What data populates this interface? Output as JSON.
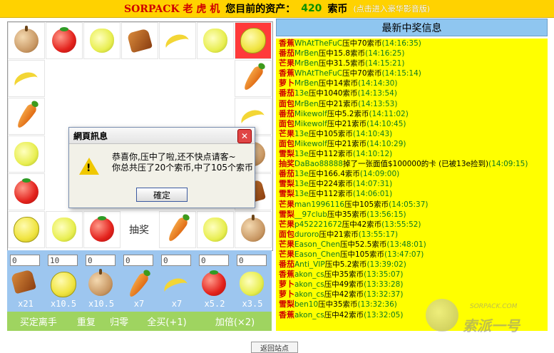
{
  "header": {
    "brand": "SORPACK 老 虎 机",
    "assets_label": "您目前的资产：",
    "assets_value": "420",
    "currency": "索币",
    "deluxe_link": "(点击进入豪华影音版)"
  },
  "board": {
    "lottery_label": "抽奖"
  },
  "bets": [
    {
      "value": "0",
      "icon": "bread-icon",
      "multiplier": "x21"
    },
    {
      "value": "10",
      "icon": "lemon-icon",
      "multiplier": "x10.5"
    },
    {
      "value": "0",
      "icon": "apple-icon",
      "multiplier": "x10.5"
    },
    {
      "value": "0",
      "icon": "carrot-icon",
      "multiplier": "x7"
    },
    {
      "value": "0",
      "icon": "banana-icon",
      "multiplier": "x7"
    },
    {
      "value": "0",
      "icon": "tomato-icon",
      "multiplier": "x5.2"
    },
    {
      "value": "0",
      "icon": "pear-icon",
      "multiplier": "x3.5"
    }
  ],
  "buttons": {
    "cash_out": "买定离手",
    "repeat": "重复",
    "reset": "归零",
    "buy_all": "全买(+1)",
    "double": "加倍(×2)"
  },
  "dialog": {
    "title": "網頁訊息",
    "line1": "恭喜你,压中了啦,还不快点请客~",
    "line2": "你总共压了20个索币,中了105个索币",
    "ok": "確定",
    "close": "✕"
  },
  "panel": {
    "title": "最新中奖信息",
    "entries": [
      {
        "fruit": "香蕉",
        "user": "WhAtTheFuC",
        "text": "压中70索币",
        "time": "(14:16:35)"
      },
      {
        "fruit": "番茄",
        "user": "MrBen",
        "text": "压中15.8索币",
        "time": "(14:16:25)"
      },
      {
        "fruit": "芒果",
        "user": "MrBen",
        "text": "压中31.5索币",
        "time": "(14:15:21)"
      },
      {
        "fruit": "香蕉",
        "user": "WhAtTheFuC",
        "text": "压中70索币",
        "time": "(14:15:14)"
      },
      {
        "fruit": "萝卜",
        "user": "MrBen",
        "text": "压中14索币",
        "time": "(14:14:30)"
      },
      {
        "fruit": "番茄",
        "user": "13e",
        "text": "压中1040索币",
        "time": "(14:13:54)"
      },
      {
        "fruit": "面包",
        "user": "MrBen",
        "text": "压中21索币",
        "time": "(14:13:53)"
      },
      {
        "fruit": "番茄",
        "user": "Mikewolf",
        "text": "压中5.2索币",
        "time": "(14:11:02)"
      },
      {
        "fruit": "面包",
        "user": "Mikewolf",
        "text": "压中21索币",
        "time": "(14:10:45)"
      },
      {
        "fruit": "芒果",
        "user": "13e",
        "text": "压中105索币",
        "time": "(14:10:43)"
      },
      {
        "fruit": "面包",
        "user": "Mikewolf",
        "text": "压中21索币",
        "time": "(14:10:29)"
      },
      {
        "fruit": "雪梨",
        "user": "13e",
        "text": "压中112索币",
        "time": "(14:10:12)"
      },
      {
        "fruit": "抽奖",
        "user": "DaBao88888",
        "text": "掉了一张面值$100000的卡 (已被13e捡到)",
        "time": "(14:09:15)"
      },
      {
        "fruit": "番茄",
        "user": "13e",
        "text": "压中166.4索币",
        "time": "(14:09:00)"
      },
      {
        "fruit": "雪梨",
        "user": "13e",
        "text": "压中224索币",
        "time": "(14:07:31)"
      },
      {
        "fruit": "雪梨",
        "user": "13e",
        "text": "压中112索币",
        "time": "(14:06:01)"
      },
      {
        "fruit": "芒果",
        "user": "man1996116",
        "text": "压中105索币",
        "time": "(14:05:37)"
      },
      {
        "fruit": "雪梨",
        "user": "__97club",
        "text": "压中35索币",
        "time": "(13:56:15)"
      },
      {
        "fruit": "芒果",
        "user": "p452221672",
        "text": "压中42索币",
        "time": "(13:55:52)"
      },
      {
        "fruit": "面包",
        "user": "duroro",
        "text": "压中21索币",
        "time": "(13:55:17)"
      },
      {
        "fruit": "芒果",
        "user": "Eason_Chen",
        "text": "压中52.5索币",
        "time": "(13:48:01)"
      },
      {
        "fruit": "芒果",
        "user": "Eason_Chen",
        "text": "压中105索币",
        "time": "(13:47:07)"
      },
      {
        "fruit": "番茄",
        "user": "Anti_VIP",
        "text": "压中5.2索币",
        "time": "(13:39:02)"
      },
      {
        "fruit": "香蕉",
        "user": "akon_cs",
        "text": "压中35索币",
        "time": "(13:35:07)"
      },
      {
        "fruit": "萝卜",
        "user": "akon_cs",
        "text": "压中49索币",
        "time": "(13:33:28)"
      },
      {
        "fruit": "萝卜",
        "user": "akon_cs",
        "text": "压中42索币",
        "time": "(13:32:37)"
      },
      {
        "fruit": "雪梨",
        "user": "ben10",
        "text": "压中35索币",
        "time": "(13:32:36)"
      },
      {
        "fruit": "香蕉",
        "user": "akon_cs",
        "text": "压中42索币",
        "time": "(13:32:05)"
      }
    ]
  },
  "watermark": {
    "url": "SORPACK.COM",
    "text": "索派一号"
  },
  "bottom_tab": "返回站点"
}
